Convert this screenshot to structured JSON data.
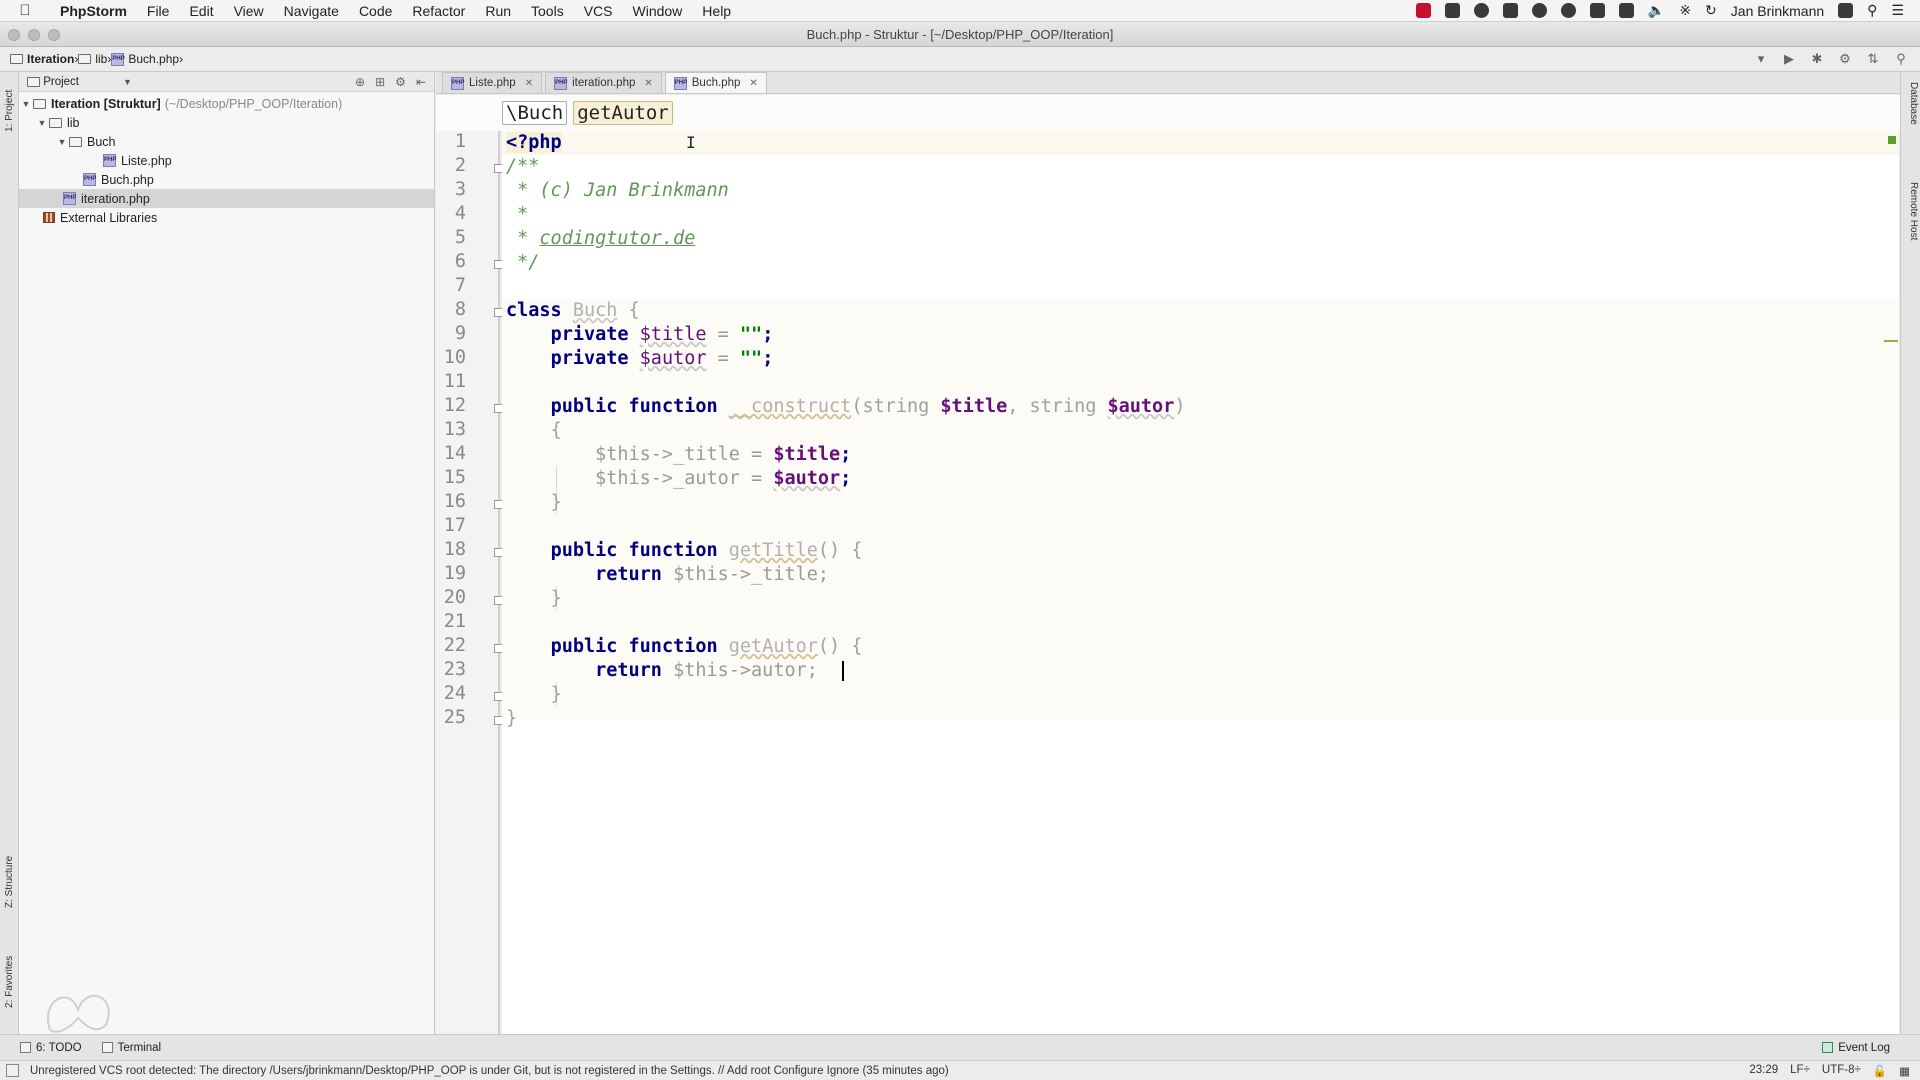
{
  "menubar": {
    "app": "PhpStorm",
    "items": [
      "File",
      "Edit",
      "View",
      "Navigate",
      "Code",
      "Refactor",
      "Run",
      "Tools",
      "VCS",
      "Window",
      "Help"
    ],
    "user": "Jan Brinkmann"
  },
  "window": {
    "title": "Buch.php - Struktur - [~/Desktop/PHP_OOP/Iteration]"
  },
  "navbar": {
    "crumbs": [
      "Iteration",
      "lib",
      "Buch.php"
    ]
  },
  "left_strip": {
    "project_tab": "1: Project",
    "structure_tab": "Z: Structure",
    "favorites_tab": "2: Favorites"
  },
  "right_strip": {
    "database_tab": "Database",
    "remote_tab": "Remote Host"
  },
  "project": {
    "header": "Project",
    "tree": [
      {
        "label": "Iteration [Struktur]",
        "suffix": "(~/Desktop/PHP_OOP/Iteration)"
      },
      {
        "label": "lib"
      },
      {
        "label": "Buch"
      },
      {
        "label": "Liste.php"
      },
      {
        "label": "Buch.php"
      },
      {
        "label": "iteration.php"
      },
      {
        "label": "External Libraries"
      }
    ]
  },
  "tabs": [
    {
      "label": "Liste.php"
    },
    {
      "label": "iteration.php"
    },
    {
      "label": "Buch.php"
    }
  ],
  "breadcrumb": {
    "class": "\\Buch",
    "method": "getAutor"
  },
  "code": {
    "line_numbers": [
      "1",
      "2",
      "3",
      "4",
      "5",
      "6",
      "7",
      "8",
      "9",
      "10",
      "11",
      "12",
      "13",
      "14",
      "15",
      "16",
      "17",
      "18",
      "19",
      "20",
      "21",
      "22",
      "23",
      "24",
      "25"
    ],
    "php_open": "<?php",
    "doc_open": "/**",
    "doc_author": " * (c) Jan Brinkmann",
    "doc_blank": " *",
    "doc_star": " * ",
    "doc_link": "codingtutor.de",
    "doc_close": " */",
    "kw_class": "class",
    "class_name": "Buch",
    "kw_private": "private",
    "var_title": "$title",
    "var_autor": "$autor",
    "eq": " = ",
    "empty_str": "\"\"",
    "semicolon": ";",
    "kw_public": "public",
    "kw_function": "function",
    "fn_construct": "__construct",
    "type_string": "string",
    "this_title_assign": "$this->_title = ",
    "this_autor_assign": "$this->_autor = ",
    "fn_gettitle": "getTitle",
    "fn_getautor": "getAutor",
    "kw_return": "return",
    "ret_title": "$this->_title;",
    "ret_autor": "$this->autor;"
  },
  "bottom_tools": {
    "todo": "6: TODO",
    "terminal": "Terminal",
    "event_log": "Event Log"
  },
  "status": {
    "message": "Unregistered VCS root detected: The directory /Users/jbrinkmann/Desktop/PHP_OOP is under Git, but is not registered in the Settings. // Add root  Configure  Ignore (35 minutes ago)",
    "position": "23:29",
    "line_sep": "LF÷",
    "encoding": "UTF-8÷"
  }
}
